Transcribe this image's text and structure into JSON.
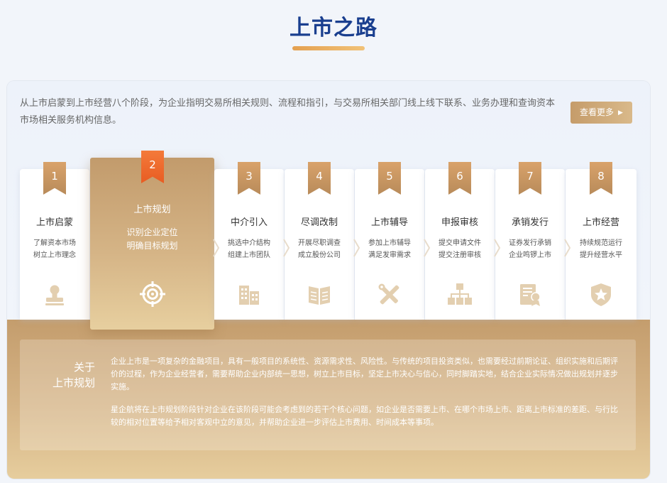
{
  "page": {
    "title": "上市之路"
  },
  "intro": {
    "text": "从上市启蒙到上市经营八个阶段，为企业指明交易所相关规则、流程和指引，与交易所相关部门线上线下联系、业务办理和查询资本市场相关服务机构信息。",
    "more_label": "查看更多"
  },
  "steps": [
    {
      "num": "1",
      "label": "上市启蒙",
      "desc1": "了解资本市场",
      "desc2": "树立上市理念",
      "icon": "stamp-icon"
    },
    {
      "num": "2",
      "label": "上市规划",
      "desc1": "识别企业定位",
      "desc2": "明确目标规划",
      "icon": "target-icon"
    },
    {
      "num": "3",
      "label": "中介引入",
      "desc1": "挑选中介结构",
      "desc2": "组建上市团队",
      "icon": "buildings-icon"
    },
    {
      "num": "4",
      "label": "尽调改制",
      "desc1": "开展尽职调查",
      "desc2": "成立股份公司",
      "icon": "book-icon"
    },
    {
      "num": "5",
      "label": "上市辅导",
      "desc1": "参加上市辅导",
      "desc2": "满足发审需求",
      "icon": "tools-icon"
    },
    {
      "num": "6",
      "label": "申报审核",
      "desc1": "提交申请文件",
      "desc2": "提交注册审核",
      "icon": "org-chart-icon"
    },
    {
      "num": "7",
      "label": "承销发行",
      "desc1": "证券发行承销",
      "desc2": "企业鸣锣上市",
      "icon": "certificate-icon"
    },
    {
      "num": "8",
      "label": "上市经营",
      "desc1": "持续规范运行",
      "desc2": "提升经营水平",
      "icon": "shield-star-icon"
    }
  ],
  "about": {
    "title_line1": "关于",
    "title_line2": "上市规划",
    "para1": "企业上市是一项复杂的金融项目，具有一般项目的系统性、资源需求性、风险性。与传统的项目投资类似，也需要经过前期论证、组织实施和后期评价的过程，作为企业经营者，需要帮助企业内部统一思想，树立上市目标，坚定上市决心与信心，同时脚踏实地，结合企业实际情况做出规划并逐步实施。",
    "para2": "星企航将在上市规划阶段针对企业在该阶段可能会考虑到的若干个核心问题，如企业是否需要上市、在哪个市场上市、距离上市标准的差距、与行比较的相对位置等给予相对客观中立的意见，并帮助企业进一步评估上市费用、时间成本等事项。"
  },
  "colors": {
    "title": "#1a3f8f",
    "accent_gold": "#c59c6a",
    "active_badge": "#f06a2e",
    "icon_muted": "#e3cfb0"
  }
}
